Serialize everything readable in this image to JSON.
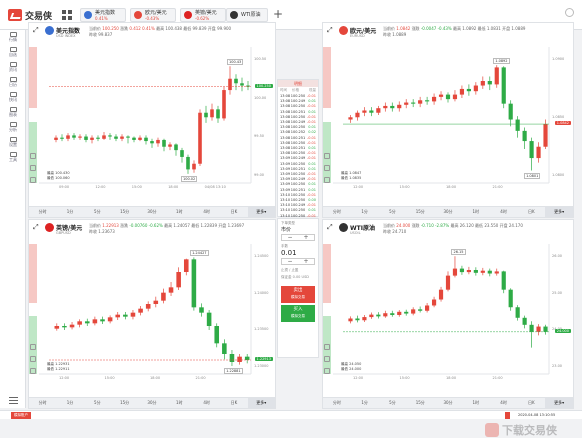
{
  "app": {
    "name": "交易侠"
  },
  "tabs": [
    {
      "name": "美元指数",
      "sub": "0.41%",
      "color": "#3a6fd0"
    },
    {
      "name": "欧元/美元",
      "sub": "-0.43%",
      "color": "#e4473b"
    },
    {
      "name": "英镑/美元",
      "sub": "-0.62%",
      "color": "#d22"
    },
    {
      "name": "WTI原油",
      "sub": "",
      "color": "#333"
    }
  ],
  "sidebar": [
    {
      "label": "行情"
    },
    {
      "label": "自选"
    },
    {
      "label": "资讯"
    },
    {
      "label": "日历"
    },
    {
      "label": "快讯"
    },
    {
      "label": "图表"
    },
    {
      "label": "分析"
    },
    {
      "label": "设置"
    },
    {
      "label": "工具"
    }
  ],
  "timeframes": [
    "分时",
    "1分",
    "5分",
    "15分",
    "30分",
    "1时",
    "4时",
    "日K",
    "更多▾"
  ],
  "panels": [
    {
      "symbol": "美元指数",
      "flag": "#3a6fd0",
      "sub": "USD INDEX",
      "quote": {
        "cur_label": "当前价",
        "cur": "100.250",
        "chg_label": "涨跌",
        "chg": "0.412",
        "pct": "0.41%",
        "high_label": "最高",
        "high": "100.438",
        "low_label": "最低",
        "low": "99.839",
        "open_label": "开盘",
        "open": "99.900"
      },
      "quote2": "昨收 99.837",
      "ticks_y": [
        "100.50",
        "100.00",
        "99.50",
        "99.00"
      ],
      "ticks_x": [
        "09:00",
        "12:00",
        "15:00",
        "18:00",
        "04/08 13:10"
      ],
      "hi_label": "100.43",
      "lo_label": "100.02",
      "price_tag": "100.250",
      "details": [
        "最高 100.430",
        "最低 100.060"
      ],
      "chart_data": {
        "type": "candlestick",
        "ylim": [
          99.4,
          100.6
        ],
        "candles": [
          [
            99.78,
            99.8,
            99.82,
            99.76
          ],
          [
            99.8,
            99.79,
            99.83,
            99.77
          ],
          [
            99.79,
            99.82,
            99.84,
            99.77
          ],
          [
            99.82,
            99.8,
            99.84,
            99.78
          ],
          [
            99.8,
            99.81,
            99.83,
            99.78
          ],
          [
            99.81,
            99.78,
            99.83,
            99.76
          ],
          [
            99.78,
            99.8,
            99.82,
            99.75
          ],
          [
            99.8,
            99.79,
            99.82,
            99.77
          ],
          [
            99.79,
            99.82,
            99.85,
            99.78
          ],
          [
            99.82,
            99.81,
            99.84,
            99.78
          ],
          [
            99.81,
            99.79,
            99.83,
            99.77
          ],
          [
            99.79,
            99.81,
            99.83,
            99.77
          ],
          [
            99.81,
            99.8,
            99.82,
            99.75
          ],
          [
            99.8,
            99.78,
            99.81,
            99.76
          ],
          [
            99.78,
            99.8,
            99.82,
            99.77
          ],
          [
            99.8,
            99.77,
            99.82,
            99.74
          ],
          [
            99.77,
            99.75,
            99.79,
            99.71
          ],
          [
            99.75,
            99.78,
            99.8,
            99.72
          ],
          [
            99.78,
            99.72,
            99.79,
            99.68
          ],
          [
            99.72,
            99.74,
            99.76,
            99.69
          ],
          [
            99.74,
            99.69,
            99.75,
            99.64
          ],
          [
            99.69,
            99.63,
            99.71,
            99.58
          ],
          [
            99.63,
            99.52,
            99.65,
            99.48
          ],
          [
            99.52,
            99.57,
            99.6,
            99.49
          ],
          [
            99.57,
            100.02,
            100.05,
            99.55
          ],
          [
            100.02,
            99.98,
            100.08,
            99.93
          ],
          [
            99.98,
            100.05,
            100.1,
            99.95
          ],
          [
            100.05,
            99.97,
            100.08,
            99.93
          ],
          [
            99.97,
            100.22,
            100.25,
            99.95
          ],
          [
            100.22,
            100.32,
            100.43,
            100.18
          ],
          [
            100.32,
            100.28,
            100.36,
            100.22
          ],
          [
            100.28,
            100.26,
            100.33,
            100.21
          ],
          [
            100.26,
            100.25,
            100.3,
            100.22
          ]
        ]
      }
    },
    {
      "symbol": "欧元/美元",
      "flag": "#e4473b",
      "sub": "EURUSD",
      "quote": {
        "cur_label": "当前价",
        "cur": "1.0842",
        "chg_label": "涨跌",
        "chg": "-0.0047",
        "pct": "-0.43%",
        "high_label": "最高",
        "high": "1.0892",
        "low_label": "最低",
        "low": "1.0831",
        "open_label": "开盘",
        "open": "1.0889"
      },
      "quote2": "昨收 1.0889",
      "ticks_y": [
        "1.0900",
        "1.0850",
        "1.0800"
      ],
      "ticks_x": [
        "12:00",
        "15:00",
        "18:00",
        "21:00"
      ],
      "hi_label": "1.0892",
      "lo_label": "1.0801",
      "price_tag": "1.0842",
      "details": [
        "最高 1.0847",
        "最低 1.0835"
      ],
      "chart_data": {
        "type": "candlestick",
        "ylim": [
          1.079,
          1.091
        ],
        "candles": [
          [
            1.0846,
            1.0848,
            1.085,
            1.0843
          ],
          [
            1.0848,
            1.0852,
            1.0854,
            1.0845
          ],
          [
            1.0852,
            1.0854,
            1.0857,
            1.0849
          ],
          [
            1.0854,
            1.0852,
            1.0857,
            1.0849
          ],
          [
            1.0852,
            1.0856,
            1.0858,
            1.085
          ],
          [
            1.0856,
            1.0858,
            1.0861,
            1.0853
          ],
          [
            1.0858,
            1.0856,
            1.0861,
            1.0853
          ],
          [
            1.0856,
            1.0859,
            1.0862,
            1.0853
          ],
          [
            1.0859,
            1.0861,
            1.0864,
            1.0856
          ],
          [
            1.0861,
            1.086,
            1.0864,
            1.0857
          ],
          [
            1.086,
            1.0863,
            1.0866,
            1.0857
          ],
          [
            1.0863,
            1.0862,
            1.0866,
            1.0859
          ],
          [
            1.0862,
            1.0866,
            1.0869,
            1.0859
          ],
          [
            1.0866,
            1.0868,
            1.0871,
            1.0863
          ],
          [
            1.0868,
            1.0864,
            1.087,
            1.0861
          ],
          [
            1.0864,
            1.0868,
            1.0872,
            1.0862
          ],
          [
            1.0868,
            1.0873,
            1.0876,
            1.0865
          ],
          [
            1.0873,
            1.0871,
            1.0877,
            1.0867
          ],
          [
            1.0871,
            1.0876,
            1.0879,
            1.0868
          ],
          [
            1.0876,
            1.088,
            1.0884,
            1.0873
          ],
          [
            1.088,
            1.0877,
            1.0884,
            1.0872
          ],
          [
            1.0877,
            1.0892,
            1.0894,
            1.0874
          ],
          [
            1.0892,
            1.086,
            1.0893,
            1.0856
          ],
          [
            1.086,
            1.0846,
            1.0863,
            1.084
          ],
          [
            1.0846,
            1.0836,
            1.0849,
            1.083
          ],
          [
            1.0836,
            1.0827,
            1.0839,
            1.082
          ],
          [
            1.0827,
            1.0812,
            1.083,
            1.0801
          ],
          [
            1.0812,
            1.0822,
            1.0826,
            1.0808
          ],
          [
            1.0822,
            1.0842,
            1.0846,
            1.082
          ]
        ]
      }
    },
    {
      "symbol": "英镑/美元",
      "flag": "#d22",
      "sub": "GBPUSD",
      "quote": {
        "cur_label": "当前价",
        "cur": "1.22913",
        "chg_label": "涨跌",
        "chg": "-0.00760",
        "pct": "-0.62%",
        "high_label": "最高",
        "high": "1.24057",
        "low_label": "最低",
        "low": "1.22839",
        "open_label": "开盘",
        "open": "1.23697"
      },
      "quote2": "昨收 1.23673",
      "ticks_y": [
        "1.24500",
        "1.24000",
        "1.23500",
        "1.23000"
      ],
      "ticks_x": [
        "12:00",
        "15:00",
        "18:00",
        "21:00"
      ],
      "hi_label": "1.24427",
      "lo_label": "1.22881",
      "price_tag": "1.22913",
      "details": [
        "最高 1.22931",
        "最低 1.22911"
      ],
      "chart_data": {
        "type": "candlestick",
        "ylim": [
          1.227,
          1.2465
        ],
        "candles": [
          [
            1.2338,
            1.2342,
            1.2346,
            1.2335
          ],
          [
            1.2342,
            1.234,
            1.2346,
            1.2336
          ],
          [
            1.234,
            1.2344,
            1.2348,
            1.2337
          ],
          [
            1.2344,
            1.2349,
            1.2352,
            1.234
          ],
          [
            1.2349,
            1.2346,
            1.2353,
            1.2342
          ],
          [
            1.2346,
            1.2352,
            1.2356,
            1.2343
          ],
          [
            1.2352,
            1.2349,
            1.2356,
            1.2345
          ],
          [
            1.2349,
            1.2355,
            1.2358,
            1.2346
          ],
          [
            1.2355,
            1.2359,
            1.2363,
            1.2351
          ],
          [
            1.2359,
            1.2356,
            1.2363,
            1.2352
          ],
          [
            1.2356,
            1.2362,
            1.2366,
            1.2352
          ],
          [
            1.2362,
            1.2368,
            1.2372,
            1.2358
          ],
          [
            1.2368,
            1.2375,
            1.2379,
            1.2364
          ],
          [
            1.2375,
            1.238,
            1.2386,
            1.237
          ],
          [
            1.238,
            1.2392,
            1.2398,
            1.2376
          ],
          [
            1.2392,
            1.24,
            1.2408,
            1.2387
          ],
          [
            1.24,
            1.2423,
            1.243,
            1.2396
          ],
          [
            1.2423,
            1.2442,
            1.2443,
            1.2418
          ],
          [
            1.2442,
            1.237,
            1.2445,
            1.2365
          ],
          [
            1.237,
            1.2362,
            1.2376,
            1.2356
          ],
          [
            1.2362,
            1.2342,
            1.2366,
            1.2336
          ],
          [
            1.2342,
            1.2316,
            1.2346,
            1.231
          ],
          [
            1.2316,
            1.23,
            1.2322,
            1.2292
          ],
          [
            1.23,
            1.2288,
            1.2306,
            1.2282
          ],
          [
            1.2288,
            1.2296,
            1.23,
            1.2284
          ],
          [
            1.2296,
            1.2291,
            1.23,
            1.2286
          ]
        ]
      }
    },
    {
      "symbol": "WTI原油",
      "flag": "#333",
      "sub": "USOIL",
      "quote": {
        "cur_label": "当前价",
        "cur": "24.000",
        "chg_label": "涨跌",
        "chg": "-0.710",
        "pct": "-2.87%",
        "high_label": "最高",
        "high": "26.120",
        "low_label": "最低",
        "low": "23.550",
        "open_label": "开盘",
        "open": "24.170"
      },
      "quote2": "昨收 24.710",
      "ticks_y": [
        "26.00",
        "25.00",
        "24.00",
        "23.00"
      ],
      "ticks_x": [
        "12:00",
        "15:00",
        "18:00",
        "21:00"
      ],
      "hi_label": "26.15",
      "lo_label": "",
      "price_tag": "24.000",
      "details": [
        "最高 24.050",
        "最低 24.000"
      ],
      "chart_data": {
        "type": "candlestick",
        "ylim": [
          22.8,
          26.5
        ],
        "candles": [
          [
            24.3,
            24.38,
            24.44,
            24.24
          ],
          [
            24.38,
            24.33,
            24.46,
            24.27
          ],
          [
            24.33,
            24.42,
            24.48,
            24.28
          ],
          [
            24.42,
            24.49,
            24.55,
            24.37
          ],
          [
            24.49,
            24.44,
            24.56,
            24.38
          ],
          [
            24.44,
            24.53,
            24.6,
            24.4
          ],
          [
            24.53,
            24.48,
            24.6,
            24.43
          ],
          [
            24.48,
            24.57,
            24.62,
            24.43
          ],
          [
            24.57,
            24.52,
            24.63,
            24.46
          ],
          [
            24.52,
            24.64,
            24.7,
            24.47
          ],
          [
            24.64,
            24.6,
            24.72,
            24.55
          ],
          [
            24.6,
            24.75,
            24.82,
            24.55
          ],
          [
            24.75,
            24.92,
            25.0,
            24.7
          ],
          [
            24.92,
            25.2,
            25.28,
            24.86
          ],
          [
            25.2,
            25.6,
            25.72,
            25.15
          ],
          [
            25.6,
            25.8,
            26.15,
            25.55
          ],
          [
            25.8,
            25.7,
            25.88,
            25.62
          ],
          [
            25.7,
            25.76,
            25.85,
            25.64
          ],
          [
            25.76,
            25.68,
            25.84,
            25.6
          ],
          [
            25.68,
            25.74,
            25.82,
            25.61
          ],
          [
            25.74,
            25.66,
            25.8,
            25.58
          ],
          [
            25.66,
            25.72,
            25.8,
            25.6
          ],
          [
            25.72,
            25.2,
            25.74,
            25.1
          ],
          [
            25.2,
            24.7,
            25.24,
            24.6
          ],
          [
            24.7,
            24.4,
            24.76,
            24.32
          ],
          [
            24.4,
            24.2,
            24.46,
            24.1
          ],
          [
            24.2,
            24.0,
            24.3,
            23.55
          ],
          [
            24.0,
            24.15,
            24.22,
            23.9
          ],
          [
            24.15,
            24.0,
            24.2,
            23.92
          ]
        ]
      }
    }
  ],
  "ladder": {
    "title": "明细",
    "cols": [
      "时间",
      "价格",
      "现量"
    ],
    "rows": [
      [
        "13:08",
        "100.250",
        "-0.01",
        "r"
      ],
      [
        "13:08",
        "100.249",
        "0.01",
        "g"
      ],
      [
        "13:08",
        "100.250",
        "-0.01",
        "r"
      ],
      [
        "13:08",
        "100.251",
        "0.01",
        "g"
      ],
      [
        "13:08",
        "100.250",
        "-0.01",
        "r"
      ],
      [
        "13:08",
        "100.249",
        "-0.01",
        "r"
      ],
      [
        "13:08",
        "100.250",
        "0.01",
        "g"
      ],
      [
        "13:08",
        "100.252",
        "0.02",
        "g"
      ],
      [
        "13:08",
        "100.251",
        "-0.01",
        "r"
      ],
      [
        "13:08",
        "100.250",
        "-0.01",
        "r"
      ],
      [
        "13:08",
        "100.251",
        "0.01",
        "g"
      ],
      [
        "13:08",
        "100.250",
        "-0.01",
        "r"
      ],
      [
        "13:09",
        "100.249",
        "-0.01",
        "r"
      ],
      [
        "13:09",
        "100.250",
        "0.01",
        "g"
      ],
      [
        "13:09",
        "100.251",
        "0.01",
        "g"
      ],
      [
        "13:09",
        "100.250",
        "-0.01",
        "r"
      ],
      [
        "13:09",
        "100.249",
        "-0.01",
        "r"
      ],
      [
        "13:09",
        "100.250",
        "0.01",
        "g"
      ],
      [
        "13:09",
        "100.251",
        "0.01",
        "g"
      ],
      [
        "13:10",
        "100.250",
        "-0.01",
        "r"
      ],
      [
        "13:10",
        "100.250",
        "0.00",
        "g"
      ],
      [
        "13:10",
        "100.249",
        "-0.01",
        "r"
      ],
      [
        "13:10",
        "100.250",
        "0.01",
        "g"
      ],
      [
        "13:10",
        "100.250",
        "-0.01",
        "r"
      ]
    ]
  },
  "order": {
    "type_label": "下单类型",
    "type_value": "市价",
    "lot_label": "手数",
    "lot_value": "0.01",
    "sl_label": "止损",
    "tp_label": "止盈",
    "note": "保证金 0.00 USD",
    "minus": "−",
    "plus": "+",
    "sell_label": "卖出",
    "sell_sub": "模拟交易",
    "buy_label": "买入",
    "buy_sub": "模拟交易"
  },
  "status": {
    "left": "模拟账户",
    "time": "2020-04-08 13:10:55"
  },
  "watermark": "下载交易侠",
  "colors": {
    "up": "#e4473b",
    "down": "#2eab46",
    "accent": "#e4473b"
  }
}
